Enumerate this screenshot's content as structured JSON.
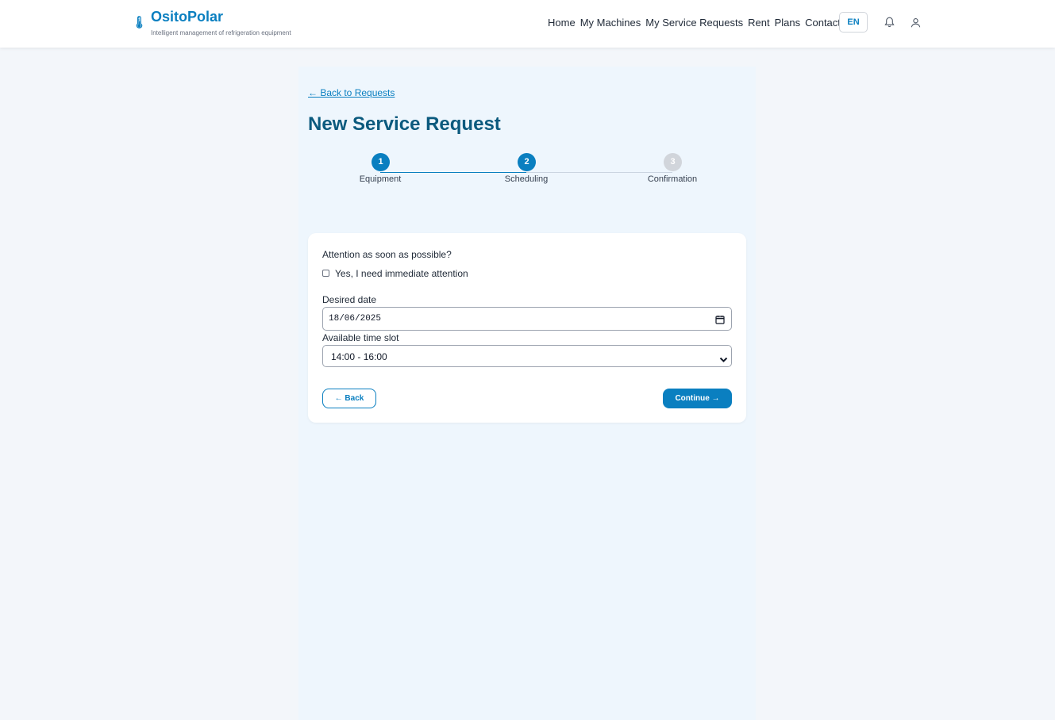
{
  "header": {
    "brand": "OsitoPolar",
    "tagline": "Intelligent management of refrigeration equipment",
    "nav": [
      "Home",
      "My Machines",
      "My Service Requests",
      "Rent",
      "Plans",
      "Contact"
    ],
    "language": "EN",
    "icons": {
      "logo": "thermometer-icon",
      "notifications": "bell-icon",
      "profile": "user-icon"
    }
  },
  "page": {
    "back_link": "← Back to Requests",
    "title": "New Service Request"
  },
  "stepper": {
    "steps": [
      {
        "number": "1",
        "label": "Equipment",
        "state": "done"
      },
      {
        "number": "2",
        "label": "Scheduling",
        "state": "active"
      },
      {
        "number": "3",
        "label": "Confirmation",
        "state": "pending"
      }
    ]
  },
  "form": {
    "urgent_question": "Attention as soon as possible?",
    "urgent_checkbox_label": "Yes, I need immediate attention",
    "urgent_checked": false,
    "date_label": "Desired date",
    "date_value": "18/06/2025",
    "timeslot_label": "Available time slot",
    "timeslot_value": "14:00 - 16:00",
    "back_button": "← Back",
    "continue_button": "Continue →"
  },
  "colors": {
    "primary": "#0a7fc0",
    "title": "#0b5a7e",
    "page_bg": "#f3f6fa",
    "column_bg": "#eef6fd",
    "step_inactive": "#d1d5db"
  }
}
